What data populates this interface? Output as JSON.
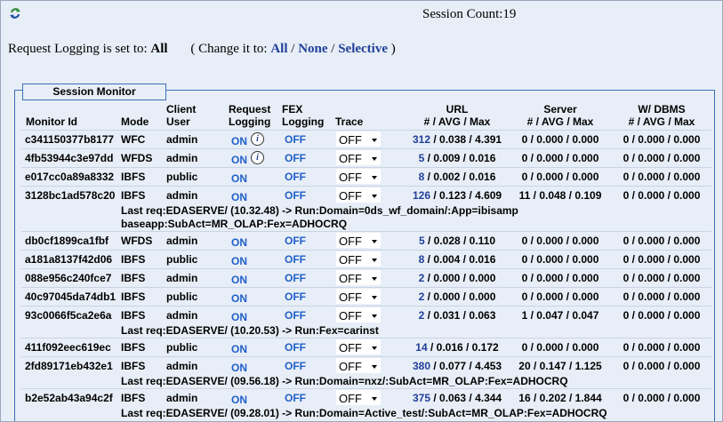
{
  "header": {
    "session_count": "Session Count:19",
    "logging_prefix": "Request Logging is set to:",
    "logging_value": "All",
    "change_prefix": "( Change it to:",
    "change_all": "All",
    "change_sep1": " / ",
    "change_none": "None",
    "change_sep2": " / ",
    "change_selective": "Selective",
    "change_suffix": " )"
  },
  "monitor": {
    "title": "Session Monitor",
    "columns": {
      "monitor_id": "Monitor Id",
      "mode": "Mode",
      "client_user_1": "Client",
      "client_user_2": "User",
      "request_logging_1": "Request",
      "request_logging_2": "Logging",
      "fex_logging_1": "FEX",
      "fex_logging_2": "Logging",
      "trace": "Trace",
      "url_1": "URL",
      "url_2": "# / AVG / Max",
      "server_1": "Server",
      "server_2": "# / AVG / Max",
      "dbms_1": "W/ DBMS",
      "dbms_2": "# / AVG / Max"
    },
    "rows": [
      {
        "id": "c341150377b8177",
        "mode": "WFC",
        "user": "admin",
        "req": "ON",
        "info": true,
        "fex": "OFF",
        "trace": "OFF",
        "url_n": "312",
        "url_rest": " / 0.038 / 4.391",
        "server": "0 / 0.000 / 0.000",
        "dbms": "0 / 0.000 / 0.000"
      },
      {
        "id": "4fb53944c3e97dd",
        "mode": "WFDS",
        "user": "admin",
        "req": "ON",
        "info": true,
        "fex": "OFF",
        "trace": "OFF",
        "url_n": "5",
        "url_rest": " / 0.009 / 0.016",
        "server": "0 / 0.000 / 0.000",
        "dbms": "0 / 0.000 / 0.000"
      },
      {
        "id": "e017cc0a89a8332",
        "mode": "IBFS",
        "user": "public",
        "req": "ON",
        "info": false,
        "fex": "OFF",
        "trace": "OFF",
        "url_n": "8",
        "url_rest": " / 0.002 / 0.016",
        "server": "0 / 0.000 / 0.000",
        "dbms": "0 / 0.000 / 0.000"
      },
      {
        "id": "3128bc1ad578c20",
        "mode": "IBFS",
        "user": "admin",
        "req": "ON",
        "info": false,
        "fex": "OFF",
        "trace": "OFF",
        "url_n": "126",
        "url_rest": " / 0.123 / 4.609",
        "server": "11 / 0.048 / 0.109",
        "dbms": "0 / 0.000 / 0.000",
        "last1": "Last req:EDASERVE/ (10.32.48) -> Run:Domain=0ds_wf_domain/:App=ibisamp",
        "last2": "baseapp:SubAct=MR_OLAP:Fex=ADHOCRQ"
      },
      {
        "id": "db0cf1899ca1fbf",
        "mode": "WFDS",
        "user": "admin",
        "req": "ON",
        "info": false,
        "fex": "OFF",
        "trace": "OFF",
        "url_n": "5",
        "url_rest": " / 0.028 / 0.110",
        "server": "0 / 0.000 / 0.000",
        "dbms": "0 / 0.000 / 0.000"
      },
      {
        "id": "a181a8137f42d06",
        "mode": "IBFS",
        "user": "public",
        "req": "ON",
        "info": false,
        "fex": "OFF",
        "trace": "OFF",
        "url_n": "8",
        "url_rest": " / 0.004 / 0.016",
        "server": "0 / 0.000 / 0.000",
        "dbms": "0 / 0.000 / 0.000"
      },
      {
        "id": "088e956c240fce7",
        "mode": "IBFS",
        "user": "admin",
        "req": "ON",
        "info": false,
        "fex": "OFF",
        "trace": "OFF",
        "url_n": "2",
        "url_rest": " / 0.000 / 0.000",
        "server": "0 / 0.000 / 0.000",
        "dbms": "0 / 0.000 / 0.000"
      },
      {
        "id": "40c97045da74db1",
        "mode": "IBFS",
        "user": "public",
        "req": "ON",
        "info": false,
        "fex": "OFF",
        "trace": "OFF",
        "url_n": "2",
        "url_rest": " / 0.000 / 0.000",
        "server": "0 / 0.000 / 0.000",
        "dbms": "0 / 0.000 / 0.000"
      },
      {
        "id": "93c0066f5ca2e6a",
        "mode": "IBFS",
        "user": "admin",
        "req": "ON",
        "info": false,
        "fex": "OFF",
        "trace": "OFF",
        "url_n": "2",
        "url_rest": " / 0.031 / 0.063",
        "server": "1 / 0.047 / 0.047",
        "dbms": "0 / 0.000 / 0.000",
        "last1": "Last req:EDASERVE/ (10.20.53) -> Run:Fex=carinst"
      },
      {
        "id": "411f092eec619ec",
        "mode": "IBFS",
        "user": "public",
        "req": "ON",
        "info": false,
        "fex": "OFF",
        "trace": "OFF",
        "url_n": "14",
        "url_rest": " / 0.016 / 0.172",
        "server": "0 / 0.000 / 0.000",
        "dbms": "0 / 0.000 / 0.000"
      },
      {
        "id": "2fd89171eb432e1",
        "mode": "IBFS",
        "user": "admin",
        "req": "ON",
        "info": false,
        "fex": "OFF",
        "trace": "OFF",
        "url_n": "380",
        "url_rest": " / 0.077 / 4.453",
        "server": "20 / 0.147 / 1.125",
        "dbms": "0 / 0.000 / 0.000",
        "last1": "Last req:EDASERVE/ (09.56.18) -> Run:Domain=nxz/:SubAct=MR_OLAP:Fex=ADHOCRQ"
      },
      {
        "id": "b2e52ab43a94c2f",
        "mode": "IBFS",
        "user": "admin",
        "req": "ON",
        "info": false,
        "fex": "OFF",
        "trace": "OFF",
        "url_n": "375",
        "url_rest": " / 0.063 / 4.344",
        "server": "16 / 0.202 / 1.844",
        "dbms": "0 / 0.000 / 0.000",
        "last1": "Last req:EDASERVE/ (09.28.01) -> Run:Domain=Active_test/:SubAct=MR_OLAP:Fex=ADHOCRQ"
      }
    ]
  }
}
